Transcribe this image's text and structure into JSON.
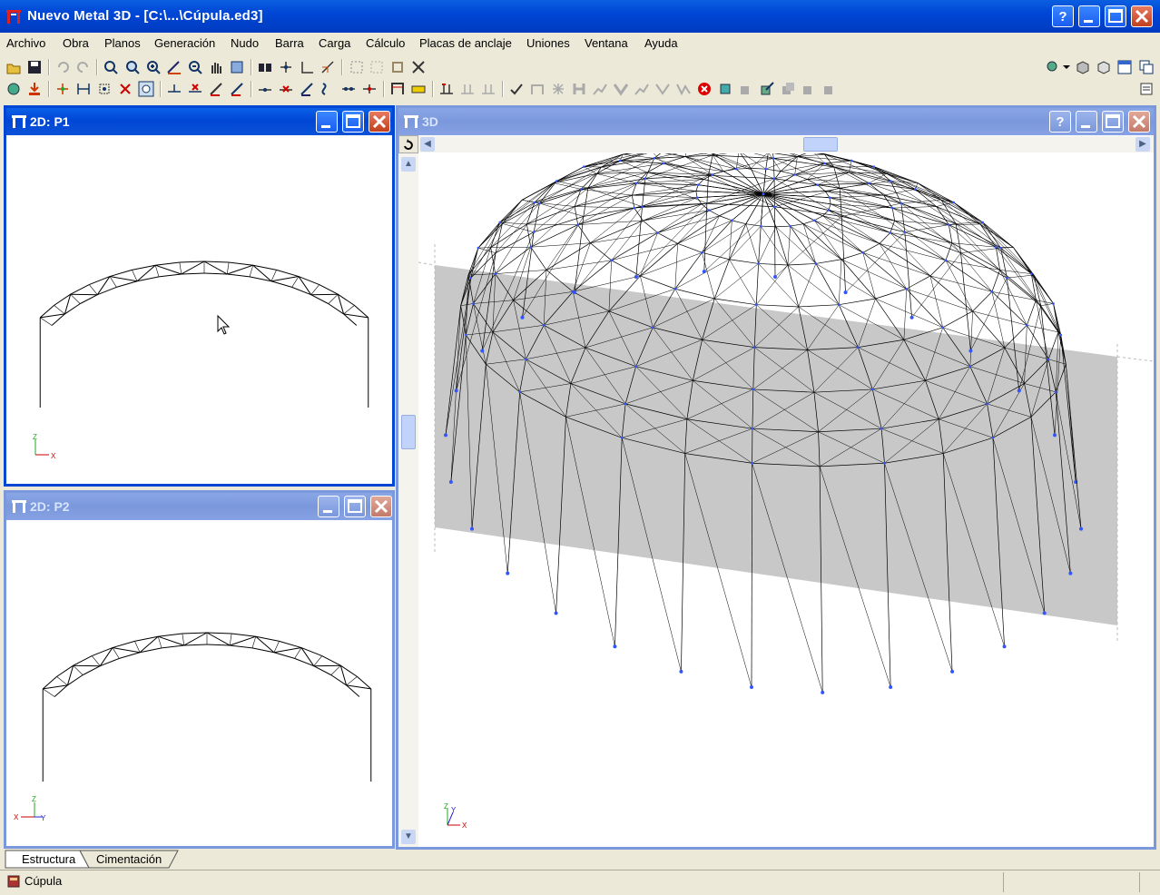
{
  "app": {
    "title": "Nuevo Metal 3D - [C:\\...\\Cúpula.ed3]"
  },
  "window_controls": {
    "help": "?",
    "minimize": "_",
    "maximize": "□",
    "close": "✕"
  },
  "menu": [
    "Archivo",
    "Obra",
    "Planos",
    "Generación",
    "Nudo",
    "Barra",
    "Carga",
    "Cálculo",
    "Placas de anclaje",
    "Uniones",
    "Ventana",
    "Ayuda"
  ],
  "windows": {
    "p1": {
      "title": "2D: P1",
      "axis_a": "Z",
      "axis_b": "X"
    },
    "p2": {
      "title": "2D: P2",
      "axis_a": "Z",
      "axis_b": "X",
      "axis_c": "Y"
    },
    "view3d": {
      "title": "3D",
      "axis_z": "Z",
      "axis_y": "Y",
      "axis_x": "X"
    }
  },
  "tabs": [
    "Estructura",
    "Cimentación"
  ],
  "status": {
    "text": "Cúpula"
  },
  "colors": {
    "title_active": "#0046d5",
    "title_inactive": "#7b98dc",
    "structure": "#000000",
    "nodes": "#3355ff",
    "plane": "#c8c8c8"
  }
}
